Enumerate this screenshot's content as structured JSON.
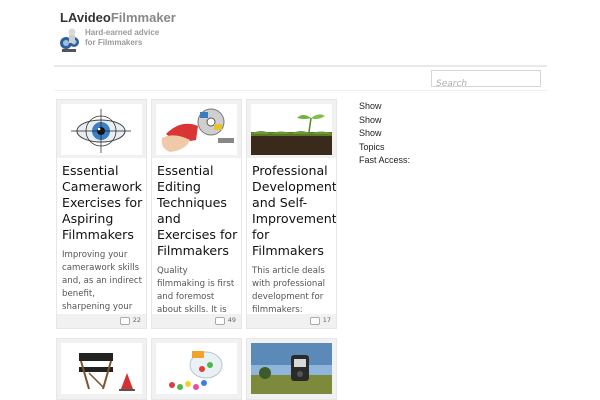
{
  "header": {
    "brand_dark": "LAvideo",
    "brand_light": "Filmmaker",
    "tagline_1": "Hard-earned advice",
    "tagline_2": "for Filmmakers"
  },
  "search": {
    "placeholder": "Search"
  },
  "cards": [
    {
      "title": "Essential Camerawork Exercises for Aspiring Filmmakers",
      "excerpt": "Improving your camerawork skills and, as an indirect benefit, sharpening your",
      "comments": "22",
      "thumb_icon": "eye-crosshair-image"
    },
    {
      "title": "Essential Editing Techniques and Exercises for Filmmakers",
      "excerpt": "Quality filmmaking is first and foremost about skills. It is the",
      "comments": "49",
      "thumb_icon": "film-reel-hand-image"
    },
    {
      "title": "Professional Development and Self-Improvement for Filmmakers",
      "excerpt": "This article deals with professional development for filmmakers:",
      "comments": "17",
      "thumb_icon": "sprout-soil-image"
    }
  ],
  "row2_thumbs": [
    "directors-chair-image",
    "candy-jar-image",
    "light-meter-field-image"
  ],
  "sidebar": {
    "items": [
      "Show",
      "Show",
      "Show",
      "Topics",
      "Fast Access:"
    ]
  },
  "colors": {
    "brand_dark": "#333333",
    "brand_light": "#888888",
    "card_frame": "#f1f1f1"
  }
}
